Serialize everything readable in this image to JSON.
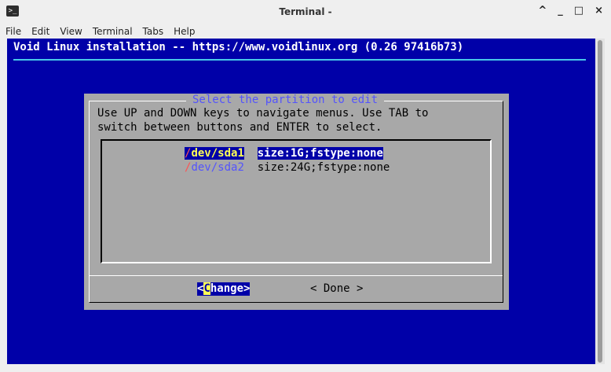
{
  "window": {
    "title": "Terminal -",
    "app_icon": ">_",
    "controls": {
      "more": "^",
      "minimize": "_",
      "maximize": "□",
      "close": "×"
    }
  },
  "menubar": [
    "File",
    "Edit",
    "View",
    "Terminal",
    "Tabs",
    "Help"
  ],
  "terminal": {
    "header": "Void Linux installation -- https://www.voidlinux.org (0.26 97416b73)",
    "colors": {
      "background": "#0000a8",
      "dialog": "#a8a8a8",
      "title": "#5454fc",
      "highlight": "#ffff54"
    }
  },
  "dialog": {
    "title": "Select the partition to edit",
    "help_line1": "Use UP and DOWN keys to navigate menus. Use TAB to",
    "help_line2": "switch between buttons and ENTER to select.",
    "partitions": [
      {
        "slash": "/",
        "device": "dev/sda1",
        "info": "size:1G;fstype:none",
        "selected": true
      },
      {
        "slash": "/",
        "device": "dev/sda2",
        "info": "size:24G;fstype:none",
        "selected": false
      }
    ],
    "buttons": {
      "change": {
        "open": "<",
        "hotkey": "C",
        "rest": "hange",
        "close": ">"
      },
      "done": "< Done >"
    }
  }
}
